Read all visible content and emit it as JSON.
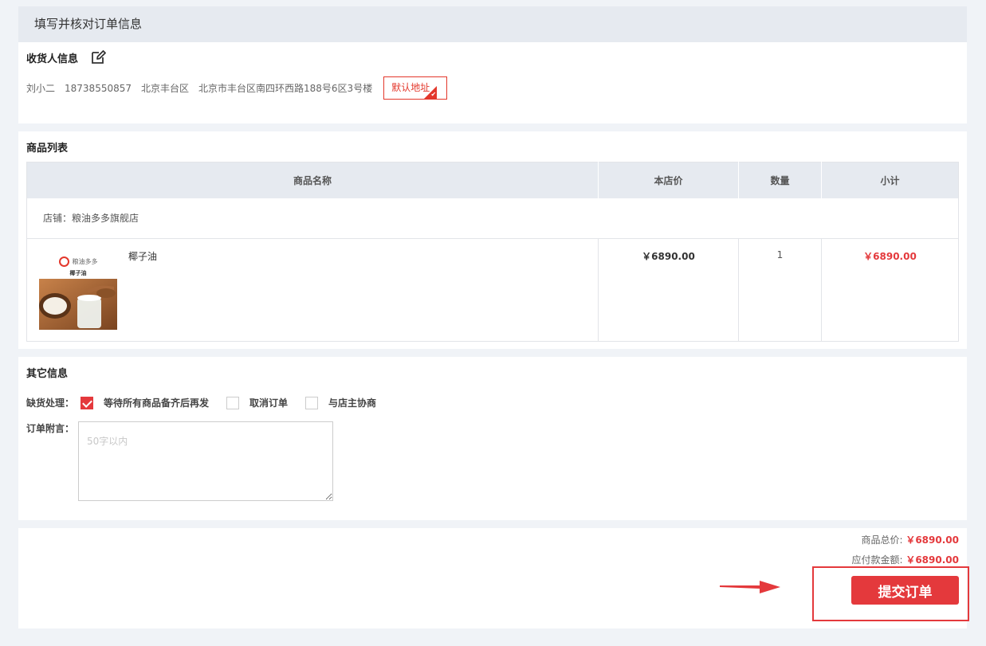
{
  "header": {
    "title": "填写并核对订单信息"
  },
  "consignee": {
    "title": "收货人信息",
    "name": "刘小二",
    "phone": "18738550857",
    "district": "北京丰台区",
    "address": "北京市丰台区南四环西路188号6区3号楼",
    "default_label": "默认地址",
    "edit_icon": "edit-icon"
  },
  "goods": {
    "title": "商品列表",
    "columns": [
      "商品名称",
      "本店价",
      "数量",
      "小计"
    ],
    "shop_label": "店铺：粮油多多旗舰店",
    "items": [
      {
        "name": "椰子油",
        "price": "￥6890.00",
        "quantity": "1",
        "subtotal": "￥6890.00",
        "thumb_logo": "粮油多多",
        "thumb_caption": "椰子油"
      }
    ]
  },
  "other": {
    "title": "其它信息",
    "stock_label": "缺货处理：",
    "stock_options": [
      {
        "label": "等待所有商品备齐后再发",
        "checked": true
      },
      {
        "label": "取消订单",
        "checked": false
      },
      {
        "label": "与店主协商",
        "checked": false
      }
    ],
    "note_label": "订单附言：",
    "note_placeholder": "50字以内"
  },
  "summary": {
    "total_label": "商品总价:",
    "total_value": "￥6890.00",
    "payable_label": "应付款金额:",
    "payable_value": "￥6890.00",
    "submit_label": "提交订单"
  },
  "colors": {
    "accent": "#e4393c",
    "header_bg": "#e6eaf0",
    "page_bg": "#f0f3f7"
  }
}
